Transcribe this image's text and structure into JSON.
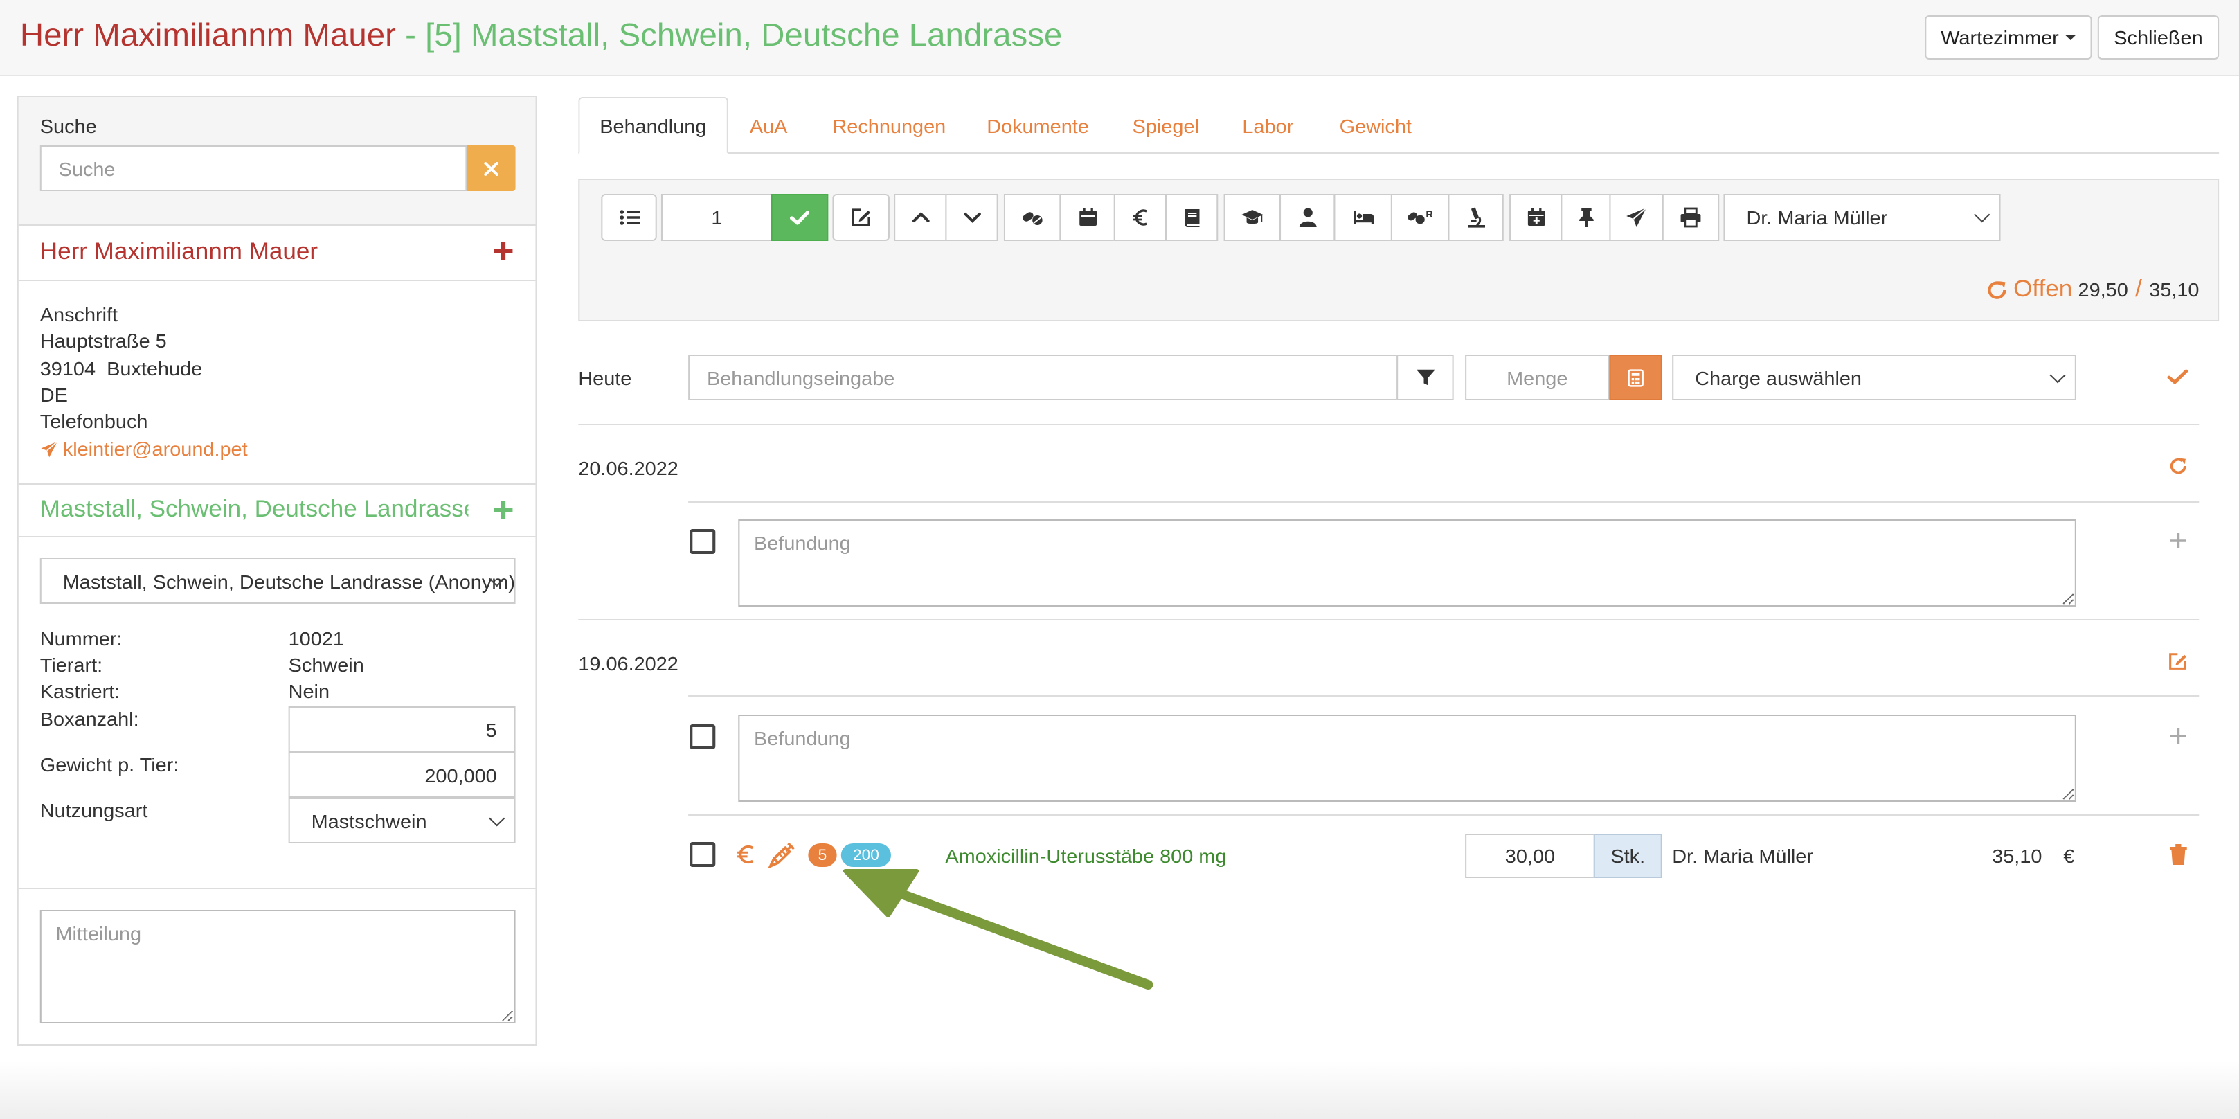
{
  "header": {
    "owner": "Herr Maximiliannm Mauer",
    "separator": " - ",
    "animal": "[5] Maststall, Schwein, Deutsche Landrasse",
    "waiting_room_label": "Wartezimmer",
    "close_label": "Schließen"
  },
  "sidebar": {
    "search_label": "Suche",
    "search_placeholder": "Suche",
    "owner_name": "Herr Maximiliannm Mauer",
    "address": {
      "heading": "Anschrift",
      "street": "Hauptstraße 5",
      "city": "39104  Buxtehude",
      "country": "DE",
      "phonebook": "Telefonbuch",
      "email": "kleintier@around.pet"
    },
    "animal_title": "Maststall, Schwein, Deutsche Landrasse",
    "animal_select": "Maststall, Schwein, Deutsche Landrasse (Anonym)",
    "details": {
      "number_label": "Nummer:",
      "number_value": "10021",
      "species_label": "Tierart:",
      "species_value": "Schwein",
      "neutered_label": "Kastriert:",
      "neutered_value": "Nein",
      "box_label": "Boxanzahl:",
      "box_value": "5",
      "weight_label": "Gewicht p. Tier:",
      "weight_value": "200,000",
      "usage_label": "Nutzungsart",
      "usage_value": "Mastschwein"
    },
    "message_placeholder": "Mitteilung"
  },
  "tabs": [
    "Behandlung",
    "AuA",
    "Rechnungen",
    "Dokumente",
    "Spiegel",
    "Labor",
    "Gewicht"
  ],
  "toolbar": {
    "count_value": "1",
    "doctor": "Dr. Maria Müller",
    "status_label": "Offen",
    "status_paid": "29,50",
    "status_sep": "/",
    "status_total": "35,10"
  },
  "entry": {
    "today_label": "Heute",
    "treatment_placeholder": "Behandlungseingabe",
    "quantity_placeholder": "Menge",
    "batch_select": "Charge auswählen"
  },
  "records": [
    {
      "date": "20.06.2022",
      "findings_placeholder": "Befundung"
    },
    {
      "date": "19.06.2022",
      "findings_placeholder": "Befundung",
      "item": {
        "badge_count": "5",
        "badge_weight": "200",
        "name": "Amoxicillin-Uterusstäbe 800 mg",
        "quantity": "30,00",
        "unit": "Stk.",
        "doctor": "Dr. Maria Müller",
        "price": "35,10",
        "currency": "€"
      }
    }
  ],
  "colors": {
    "owner_red": "#b5342f",
    "animal_green": "#6bbf73",
    "accent_orange": "#e8803e",
    "confirm_green": "#5cb85c",
    "badge_blue": "#5bc0de",
    "arrow_green": "#7a9a3c"
  }
}
